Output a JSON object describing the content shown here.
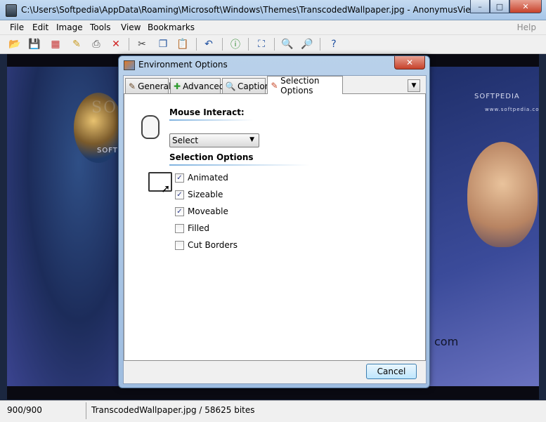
{
  "window": {
    "title": "C:\\Users\\Softpedia\\AppData\\Roaming\\Microsoft\\Windows\\Themes\\TranscodedWallpaper.jpg - AnonymusViewer",
    "minimize": "–",
    "maximize": "□",
    "close": "✕"
  },
  "menu": {
    "items": [
      "File",
      "Edit",
      "Image",
      "Tools",
      "View",
      "Bookmarks"
    ],
    "help": "Help"
  },
  "toolbar_icons": [
    "open-icon",
    "save-icon",
    "thumbnails-icon",
    "edit-icon",
    "print-icon",
    "delete-icon",
    "cut-icon",
    "copy-icon",
    "paste-icon",
    "undo-icon",
    "info-icon",
    "fullscreen-icon",
    "zoom-in-icon",
    "zoom-out-icon",
    "help-icon"
  ],
  "background": {
    "watermark": "SOFTPEDIA",
    "logo": "SOFTPEDIA",
    "logo_sub": "www.softpedia.com",
    "com_text": "com"
  },
  "status": {
    "size": "900/900",
    "file": "TranscodedWallpaper.jpg / 58625 bites"
  },
  "dialog": {
    "title": "Environment Options",
    "close": "✕",
    "tabs": [
      "General",
      "Advanced",
      "Caption",
      "Selection Options"
    ],
    "active_tab": "Selection Options",
    "mouse_interact_label": "Mouse Interact:",
    "mouse_select_value": "Select",
    "selection_options_label": "Selection Options",
    "options": [
      {
        "label": "Animated",
        "checked": true
      },
      {
        "label": "Sizeable",
        "checked": true
      },
      {
        "label": "Moveable",
        "checked": true
      },
      {
        "label": "Filled",
        "checked": false
      },
      {
        "label": "Cut Borders",
        "checked": false
      }
    ],
    "check_mark": "✓",
    "cancel_label": "Cancel"
  }
}
